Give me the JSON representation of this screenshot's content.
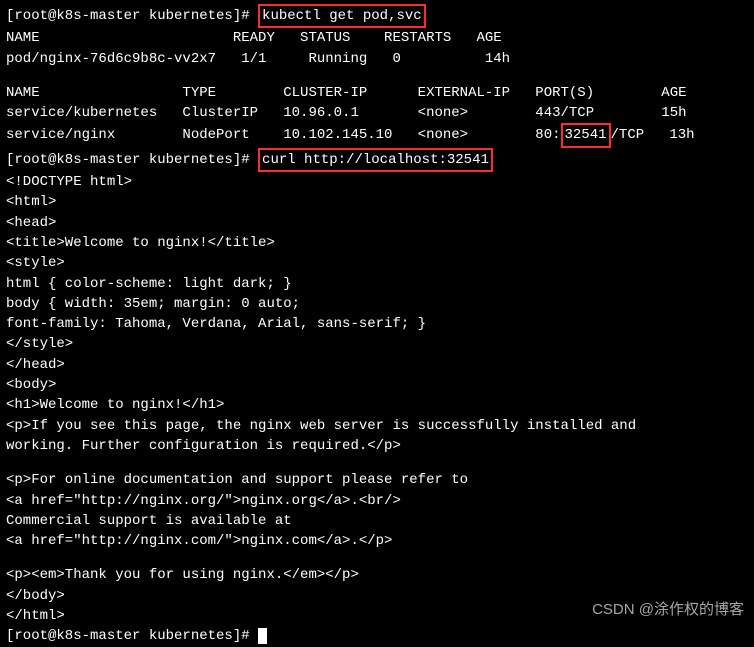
{
  "prompt": "[root@k8s-master kubernetes]# ",
  "cmd1": "kubectl get pod,svc",
  "pods_header": "NAME                       READY   STATUS    RESTARTS   AGE",
  "pods_row": "pod/nginx-76d6c9b8c-vv2x7   1/1     Running   0          14h",
  "svc_header": "NAME                 TYPE        CLUSTER-IP      EXTERNAL-IP   PORT(S)        AGE",
  "svc_row1": "service/kubernetes   ClusterIP   10.96.0.1       <none>        443/TCP        15h",
  "svc_row2_a": "service/nginx        NodePort    10.102.145.10   <none>        80:",
  "svc_row2_port": "32541",
  "svc_row2_b": "/TCP   13h",
  "cmd2": "curl http://localhost:32541",
  "html_lines": [
    "<!DOCTYPE html>",
    "<html>",
    "<head>",
    "<title>Welcome to nginx!</title>",
    "<style>",
    "html { color-scheme: light dark; }",
    "body { width: 35em; margin: 0 auto;",
    "font-family: Tahoma, Verdana, Arial, sans-serif; }",
    "</style>",
    "</head>",
    "<body>",
    "<h1>Welcome to nginx!</h1>",
    "<p>If you see this page, the nginx web server is successfully installed and",
    "working. Further configuration is required.</p>",
    "",
    "<p>For online documentation and support please refer to",
    "<a href=\"http://nginx.org/\">nginx.org</a>.<br/>",
    "Commercial support is available at",
    "<a href=\"http://nginx.com/\">nginx.com</a>.</p>",
    "",
    "<p><em>Thank you for using nginx.</em></p>",
    "</body>",
    "</html>"
  ],
  "watermark": "CSDN @涂作权的博客"
}
